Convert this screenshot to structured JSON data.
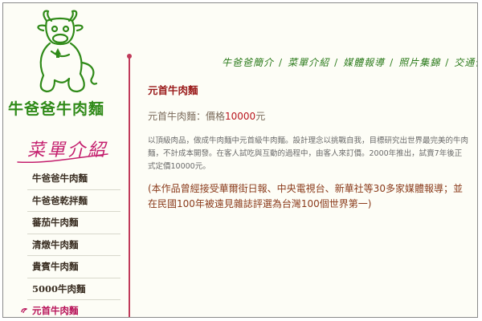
{
  "brand": {
    "name": "牛爸爸牛肉麵",
    "logo_icon": "cartoon-cow-logo-icon"
  },
  "nav": {
    "items": [
      {
        "label": "牛爸爸簡介"
      },
      {
        "label": "菜單介紹"
      },
      {
        "label": "媒體報導"
      },
      {
        "label": "照片集錦"
      },
      {
        "label": "交通位置"
      }
    ],
    "separator": "/"
  },
  "sidebar": {
    "title": "菜單介紹",
    "items": [
      {
        "label": "牛爸爸牛肉麵"
      },
      {
        "label": "牛爸爸乾拌麵"
      },
      {
        "label": "蕃茄牛肉麵"
      },
      {
        "label": "清燉牛肉麵"
      },
      {
        "label": "貴賓牛肉麵"
      },
      {
        "label": "5000牛肉麵"
      },
      {
        "label": "元首牛肉麵",
        "active": true
      }
    ]
  },
  "content": {
    "title": "元首牛肉麵",
    "price_label": "元首牛肉麵：價格",
    "price_value": "10000",
    "price_unit": "元",
    "description": "以頂級肉品，做成牛肉麵中元首級牛肉麵。設計理念以挑戰自我，目標研究出世界最完美的牛肉麵，不計成本開發。在客人試吃與互動的過程中，由客人來訂價。2000年推出，試賣7年後正式定價10000元。",
    "award": "(本作品曾經接受華爾街日報、中央電視台、新華社等30多家媒體報導；並在民國100年被遠見雜誌評選為台灣100個世界第一)"
  },
  "colors": {
    "brand_green": "#2f8a18",
    "menu_title_pink": "#c41f6e",
    "divider_red": "#c03a5a",
    "price_red": "#b8141c",
    "title_red": "#9a1a1a"
  }
}
